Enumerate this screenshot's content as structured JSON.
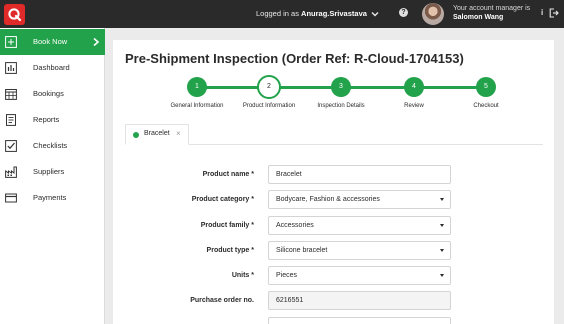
{
  "topbar": {
    "login_prefix": "Logged in as ",
    "username": "Anurag.Srivastava",
    "help_label": "?",
    "manager_label": "Your account manager is",
    "manager_name": "Salomon Wang"
  },
  "sidebar": {
    "items": [
      {
        "label": "Book Now",
        "icon": "plus-square-icon"
      },
      {
        "label": "Dashboard",
        "icon": "bar-chart-icon"
      },
      {
        "label": "Bookings",
        "icon": "calendar-icon"
      },
      {
        "label": "Reports",
        "icon": "document-icon"
      },
      {
        "label": "Checklists",
        "icon": "checkbox-icon"
      },
      {
        "label": "Suppliers",
        "icon": "factory-icon"
      },
      {
        "label": "Payments",
        "icon": "credit-card-icon"
      }
    ]
  },
  "page": {
    "title": "Pre-Shipment Inspection (Order Ref: R-Cloud-1704153)"
  },
  "steps": [
    {
      "number": "1",
      "label": "General Information"
    },
    {
      "number": "2",
      "label": "Product Information"
    },
    {
      "number": "3",
      "label": "Inspection Details"
    },
    {
      "number": "4",
      "label": "Review"
    },
    {
      "number": "5",
      "label": "Checkout"
    }
  ],
  "tabs": [
    {
      "label": "Bracelet",
      "close": "×"
    }
  ],
  "form": {
    "fields": [
      {
        "label": "Product name *",
        "value": "Bracelet"
      },
      {
        "label": "Product category *",
        "value": "Bodycare, Fashion & accessories"
      },
      {
        "label": "Product family *",
        "value": "Accessories"
      },
      {
        "label": "Product type *",
        "value": "Silicone bracelet"
      },
      {
        "label": "Units *",
        "value": "Pieces"
      },
      {
        "label": "Purchase order no.",
        "value": "6216551"
      }
    ]
  },
  "colors": {
    "accent": "#22a24a",
    "brand": "#e02a2a",
    "topbar": "#2a2a2a"
  }
}
